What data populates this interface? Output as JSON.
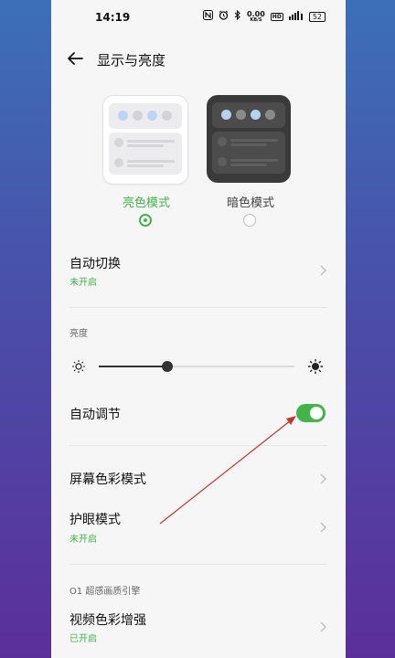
{
  "status": {
    "time": "14:19",
    "nfc_icon": "nfc-icon",
    "alarm_icon": "alarm-icon",
    "bluetooth_icon": "bluetooth-icon",
    "net_speed_value": "0.00",
    "net_speed_unit": "KB/S",
    "hd_label": "HD",
    "signal_icon": "signal-icon",
    "battery": "52"
  },
  "header": {
    "title": "显示与亮度",
    "back_icon": "back-arrow-icon"
  },
  "theme": {
    "light_label": "亮色模式",
    "dark_label": "暗色模式",
    "selected": "light",
    "accent_color": "#43b34a"
  },
  "settings": {
    "auto_switch": {
      "title": "自动切换",
      "status": "未开启"
    },
    "brightness_label": "亮度",
    "brightness_level": 0.35,
    "auto_adjust": {
      "title": "自动调节",
      "enabled": true
    },
    "screen_color": {
      "title": "屏幕色彩模式"
    },
    "eye_care": {
      "title": "护眼模式",
      "status": "未开启"
    },
    "engine_label": "O1 超感画质引擎",
    "video_color": {
      "title": "视频色彩增强",
      "status": "已开启"
    }
  }
}
